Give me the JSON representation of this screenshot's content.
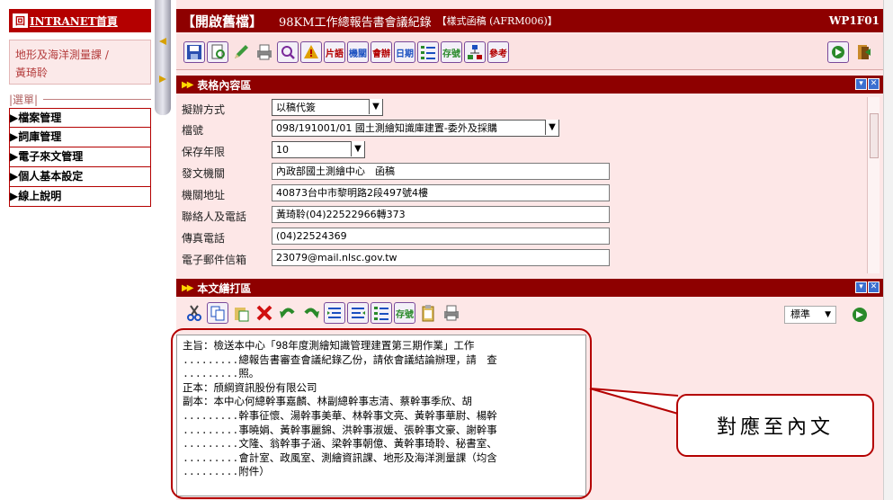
{
  "sidebar": {
    "logo_label": "INTRANET首頁",
    "logo_mark": "回",
    "user": {
      "dept": "地形及海洋測量課 /",
      "name": "黃琦聆"
    },
    "menu_heading": "|選單|",
    "menu_items": [
      "▶檔案管理",
      "▶詞庫管理",
      "▶電子來文管理",
      "▶個人基本設定",
      "▶線上說明"
    ]
  },
  "titlebar": {
    "open_label": "【開啟舊檔】",
    "doc_title": "98KM工作總報告書會議紀錄",
    "form_label": "【樣式函稿 (AFRM006)】",
    "code": "WP1F01"
  },
  "toolbar1": {
    "buttons": [
      "save-icon",
      "print-preview-icon",
      "edit-icon",
      "print-icon",
      "search-icon",
      "warning-icon",
      "片語",
      "機關",
      "會辦",
      "日期",
      "list-icon",
      "存號",
      "org-chart-icon",
      "參考",
      "export-icon",
      "exit-icon"
    ]
  },
  "form_section": {
    "title": "表格內容區",
    "rows": [
      {
        "label": "擬辦方式",
        "value": "以稿代簽",
        "type": "select"
      },
      {
        "label": "檔號",
        "value": "098/191001/01 國土測繪知識庫建置-委外及採購",
        "type": "select"
      },
      {
        "label": "保存年限",
        "value": "10",
        "type": "select"
      },
      {
        "label": "發文機關",
        "value": "內政部國土測繪中心　函稿",
        "type": "text"
      },
      {
        "label": "機關地址",
        "value": "40873台中市黎明路2段497號4樓",
        "type": "text"
      },
      {
        "label": "聯絡人及電話",
        "value": "黃琦聆(04)22522966轉373",
        "type": "text"
      },
      {
        "label": "傳真電話",
        "value": "(04)22524369",
        "type": "text"
      },
      {
        "label": "電子郵件信箱",
        "value": "23079@mail.nlsc.gov.tw",
        "type": "text"
      }
    ]
  },
  "body_section": {
    "title": "本文繕打區",
    "style_select": "標準",
    "lines": [
      {
        "prefix": "",
        "text": "主旨：檢送本中心「98年度測繪知識管理建置第三期作業」工作"
      },
      {
        "prefix": ".........",
        "text": "總報告書審查會議紀錄乙份，請依會議結論辦理，請　查"
      },
      {
        "prefix": ".........",
        "text": "照。"
      },
      {
        "prefix": "",
        "text": "正本：頎綱資訊股份有限公司"
      },
      {
        "prefix": "",
        "text": "副本：本中心何總幹事嘉麟、林副總幹事志清、蔡幹事季欣、胡"
      },
      {
        "prefix": ".........",
        "text": "幹事征懷、湯幹事美華、林幹事文亮、黃幹事華尉、楊幹"
      },
      {
        "prefix": ".........",
        "text": "事曉娟、黃幹事麗錦、洪幹事淑媛、張幹事文豪、謝幹事"
      },
      {
        "prefix": ".........",
        "text": "文隆、翁幹事子涵、梁幹事朝億、黃幹事琦聆、秘書室、"
      },
      {
        "prefix": ".........",
        "text": "會計室、政風室、測繪資訊課、地形及海洋測量課（均含"
      },
      {
        "prefix": ".........",
        "text": "附件）"
      }
    ]
  },
  "callout": {
    "text": "對應至內文"
  },
  "colors": {
    "brand": "#8e0000",
    "menu_border": "#b40000",
    "pane_bg": "#fde7e7",
    "annotation": "#b40000"
  }
}
